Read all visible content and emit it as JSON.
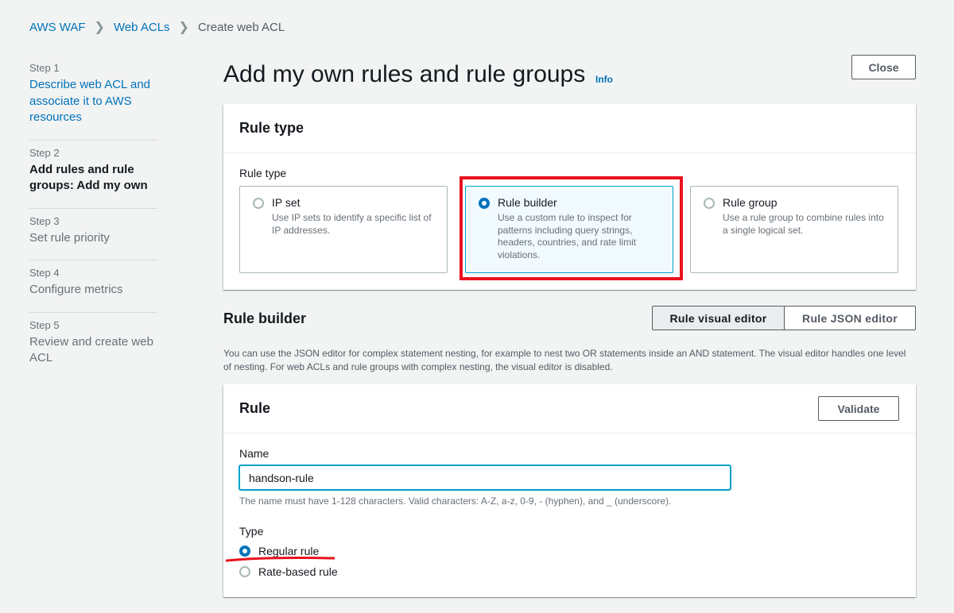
{
  "breadcrumb": {
    "items": [
      "AWS WAF",
      "Web ACLs"
    ],
    "current": "Create web ACL"
  },
  "steps": [
    {
      "num": "Step 1",
      "title": "Describe web ACL and associate it to AWS resources"
    },
    {
      "num": "Step 2",
      "title": "Add rules and rule groups: Add my own"
    },
    {
      "num": "Step 3",
      "title": "Set rule priority"
    },
    {
      "num": "Step 4",
      "title": "Configure metrics"
    },
    {
      "num": "Step 5",
      "title": "Review and create web ACL"
    }
  ],
  "page": {
    "title": "Add my own rules and rule groups",
    "info": "Info",
    "close": "Close"
  },
  "rule_type_panel": {
    "header": "Rule type",
    "label": "Rule type",
    "tiles": [
      {
        "title": "IP set",
        "desc": "Use IP sets to identify a specific list of IP addresses.",
        "selected": false
      },
      {
        "title": "Rule builder",
        "desc": "Use a custom rule to inspect for patterns including query strings, headers, countries, and rate limit violations.",
        "selected": true
      },
      {
        "title": "Rule group",
        "desc": "Use a rule group to combine rules into a single logical set.",
        "selected": false
      }
    ]
  },
  "rule_builder": {
    "title": "Rule builder",
    "visual_editor": "Rule visual editor",
    "json_editor": "Rule JSON editor",
    "description": "You can use the JSON editor for complex statement nesting, for example to nest two OR statements inside an AND statement. The visual editor handles one level of nesting. For web ACLs and rule groups with complex nesting, the visual editor is disabled."
  },
  "rule_panel": {
    "header": "Rule",
    "validate": "Validate",
    "name_label": "Name",
    "name_value": "handson-rule",
    "name_hint": "The name must have 1-128 characters. Valid characters: A-Z, a-z, 0-9, - (hyphen), and _ (underscore).",
    "type_label": "Type",
    "type_options": [
      "Regular rule",
      "Rate-based rule"
    ],
    "type_selected": "Regular rule"
  },
  "colors": {
    "link": "#0073bb",
    "annotation_red": "#e7131e",
    "selected_tile_bg": "#f1faff"
  }
}
